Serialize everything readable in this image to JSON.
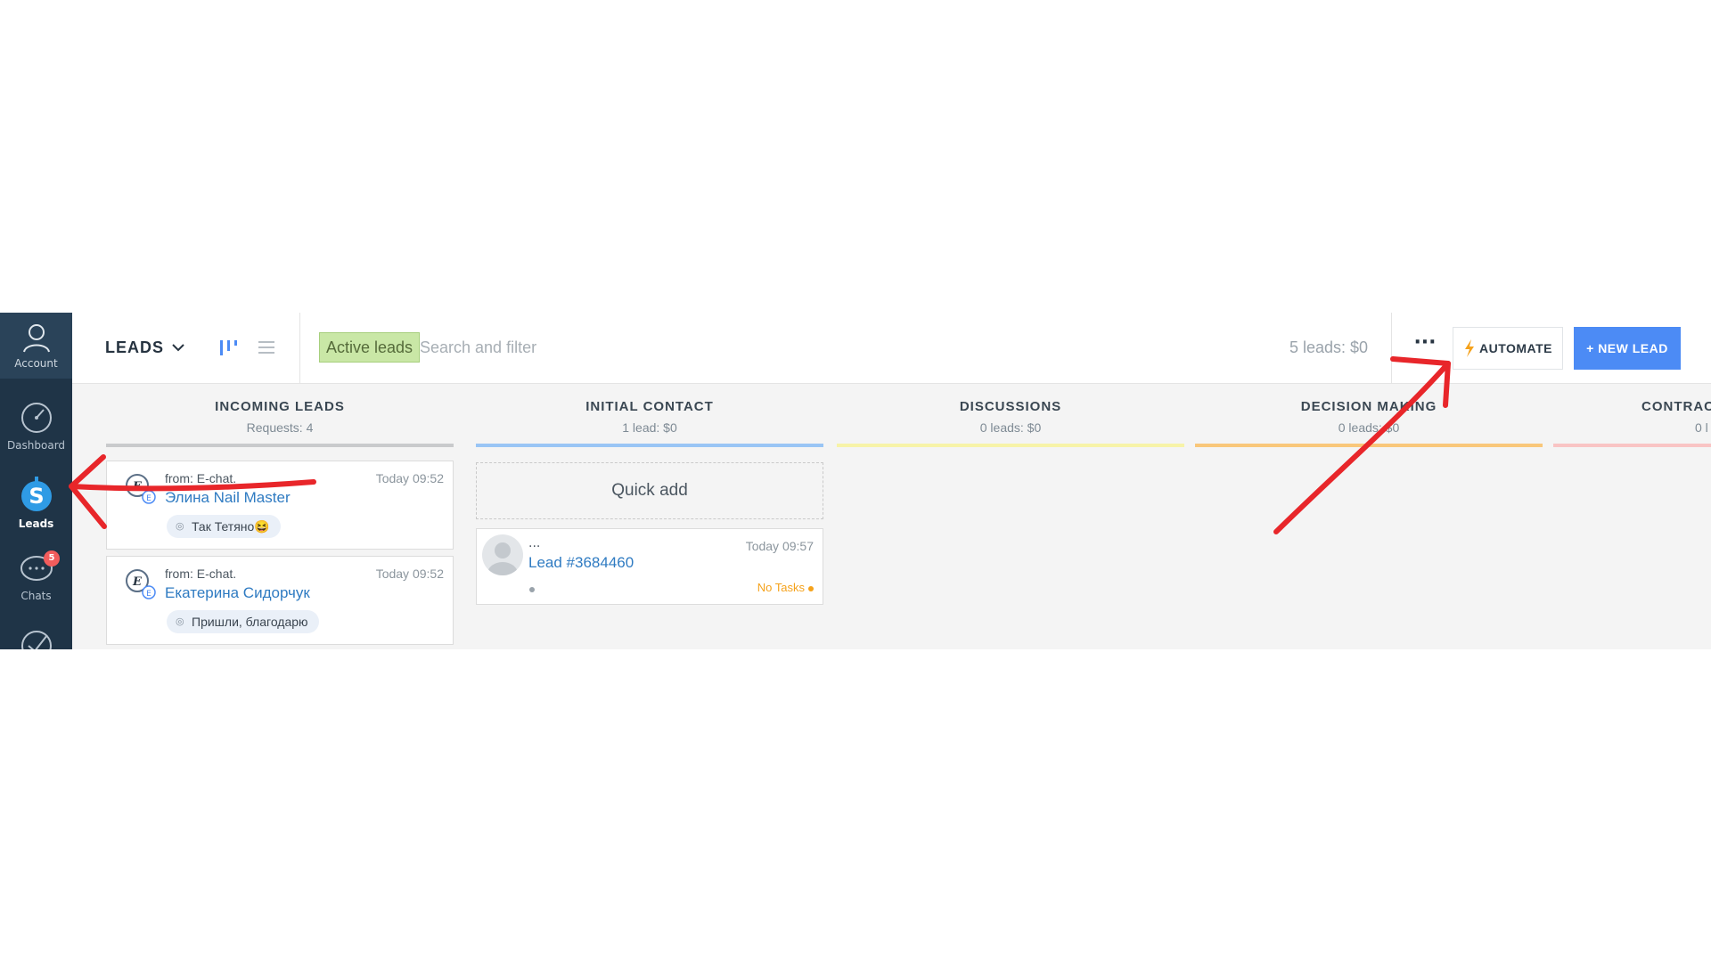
{
  "sidebar": {
    "items": [
      {
        "label": "Account",
        "icon": "account-icon"
      },
      {
        "label": "Dashboard",
        "icon": "dashboard-icon"
      },
      {
        "label": "Leads",
        "icon": "leads-icon"
      },
      {
        "label": "Chats",
        "icon": "chats-icon",
        "badge": "5"
      },
      {
        "label": "",
        "icon": "tasks-icon"
      }
    ]
  },
  "header": {
    "title": "LEADS",
    "filter_chip": "Active leads",
    "search_placeholder": "Search and filter",
    "summary": "5 leads: $0",
    "more_label": "···",
    "automate_label": "AUTOMATE",
    "new_lead_label": "+ NEW LEAD"
  },
  "columns": [
    {
      "title": "INCOMING LEADS",
      "sub": "Requests: 4",
      "color": "#c9cacc"
    },
    {
      "title": "INITIAL CONTACT",
      "sub": "1 lead: $0",
      "color": "#99c5f5"
    },
    {
      "title": "DISCUSSIONS",
      "sub": "0 leads: $0",
      "color": "#f7f3a8"
    },
    {
      "title": "DECISION MAKING",
      "sub": "0 leads: $0",
      "color": "#f9c77a"
    },
    {
      "title": "CONTRACT",
      "sub": "0 l",
      "color": "#f9c4c4"
    }
  ],
  "incoming_cards": [
    {
      "from": "from: E-chat.",
      "time": "Today 09:52",
      "name": "Элина Nail Master",
      "message": "Так Тетяно😆"
    },
    {
      "from": "from: E-chat.",
      "time": "Today 09:52",
      "name": "Екатерина Сидорчук",
      "message": "Пришли, благодарю"
    }
  ],
  "quick_add": "Quick add",
  "lead_card": {
    "dots": "...",
    "time": "Today 09:57",
    "name": "Lead #3684460",
    "tasks": "No Tasks"
  },
  "colors": {
    "sidebar": "#1f3447",
    "accent": "#4c8bf5",
    "link": "#2f7bc2",
    "filter_chip": "#c9e7a6",
    "annotation_arrow": "#e8262a"
  }
}
